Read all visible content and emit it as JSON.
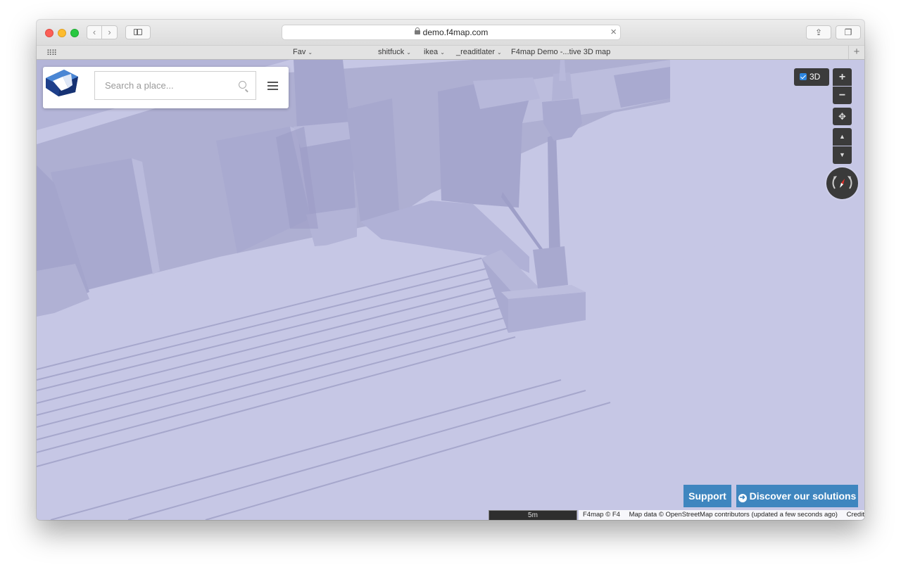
{
  "browser": {
    "url": "demo.f4map.com",
    "bookmarks": {
      "fav": "Fav",
      "shitfuck": "shitfuck",
      "ikea": "ikea",
      "readitlater": "_readitlater",
      "f4map_demo": "F4map Demo -...tive 3D map"
    },
    "add_tab": "+"
  },
  "search": {
    "placeholder": "Search a place..."
  },
  "map_controls": {
    "toggle_3d_label": "3D",
    "zoom_in": "+",
    "zoom_out": "−"
  },
  "footer": {
    "support_label": "Support",
    "discover_label": "Discover our solutions",
    "scale_label": "5m",
    "credit_f4": "F4map © F4",
    "credit_osm": "Map data © OpenStreetMap contributors (updated a few seconds ago)",
    "credits_link": "Credits"
  },
  "colors": {
    "map_ground": "#c6c7e5",
    "button_blue": "#3f86bf",
    "control_dark": "#3b3b3b"
  }
}
